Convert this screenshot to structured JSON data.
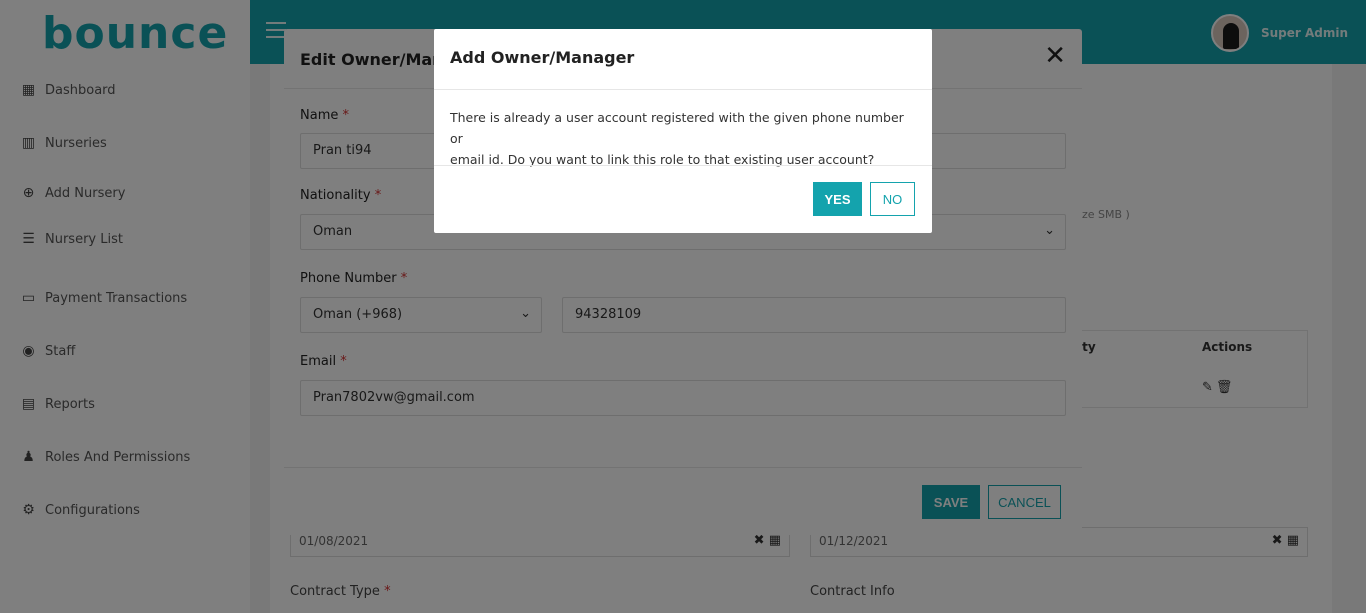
{
  "app": {
    "logo_text": "bounce",
    "user_name": "Super Admin"
  },
  "sidebar": {
    "items": [
      {
        "label": "Dashboard",
        "icon": "dashboard-icon"
      },
      {
        "label": "Nurseries",
        "icon": "building-icon"
      },
      {
        "label": "Add Nursery",
        "icon": "plus-circle-icon"
      },
      {
        "label": "Nursery List",
        "icon": "list-icon"
      },
      {
        "label": "Payment Transactions",
        "icon": "credit-card-icon"
      },
      {
        "label": "Staff",
        "icon": "user-circle-icon"
      },
      {
        "label": "Reports",
        "icon": "report-icon"
      },
      {
        "label": "Roles And Permissions",
        "icon": "users-icon"
      },
      {
        "label": "Configurations",
        "icon": "gear-icon"
      }
    ]
  },
  "background": {
    "smb_text": "ze SMB )",
    "table_headers": [
      "ity",
      "Actions"
    ],
    "start_date": "01/08/2021",
    "end_date": "01/12/2021",
    "contract_type_label": "Contract Type",
    "contract_info_label": "Contract Info"
  },
  "edit_modal": {
    "title": "Edit Owner/Mana",
    "name_label": "Name",
    "name_value": "Pran ti94",
    "nationality_label": "Nationality",
    "nationality_value": "Oman",
    "phone_label": "Phone Number",
    "phone_code_value": "Oman (+968)",
    "phone_value": "94328109",
    "email_label": "Email",
    "email_value": "Pran7802vw@gmail.com",
    "save_label": "SAVE",
    "cancel_label": "CANCEL",
    "close_symbol": "✕"
  },
  "confirm_dialog": {
    "title": "Add Owner/Manager",
    "message_line1": "There is already a user account registered with the given phone number or",
    "message_line2": "email id. Do you want to link this role to that existing user account?",
    "yes_label": "YES",
    "no_label": "NO"
  },
  "colors": {
    "accent": "#14a3ad",
    "required": "#d32f2f"
  }
}
